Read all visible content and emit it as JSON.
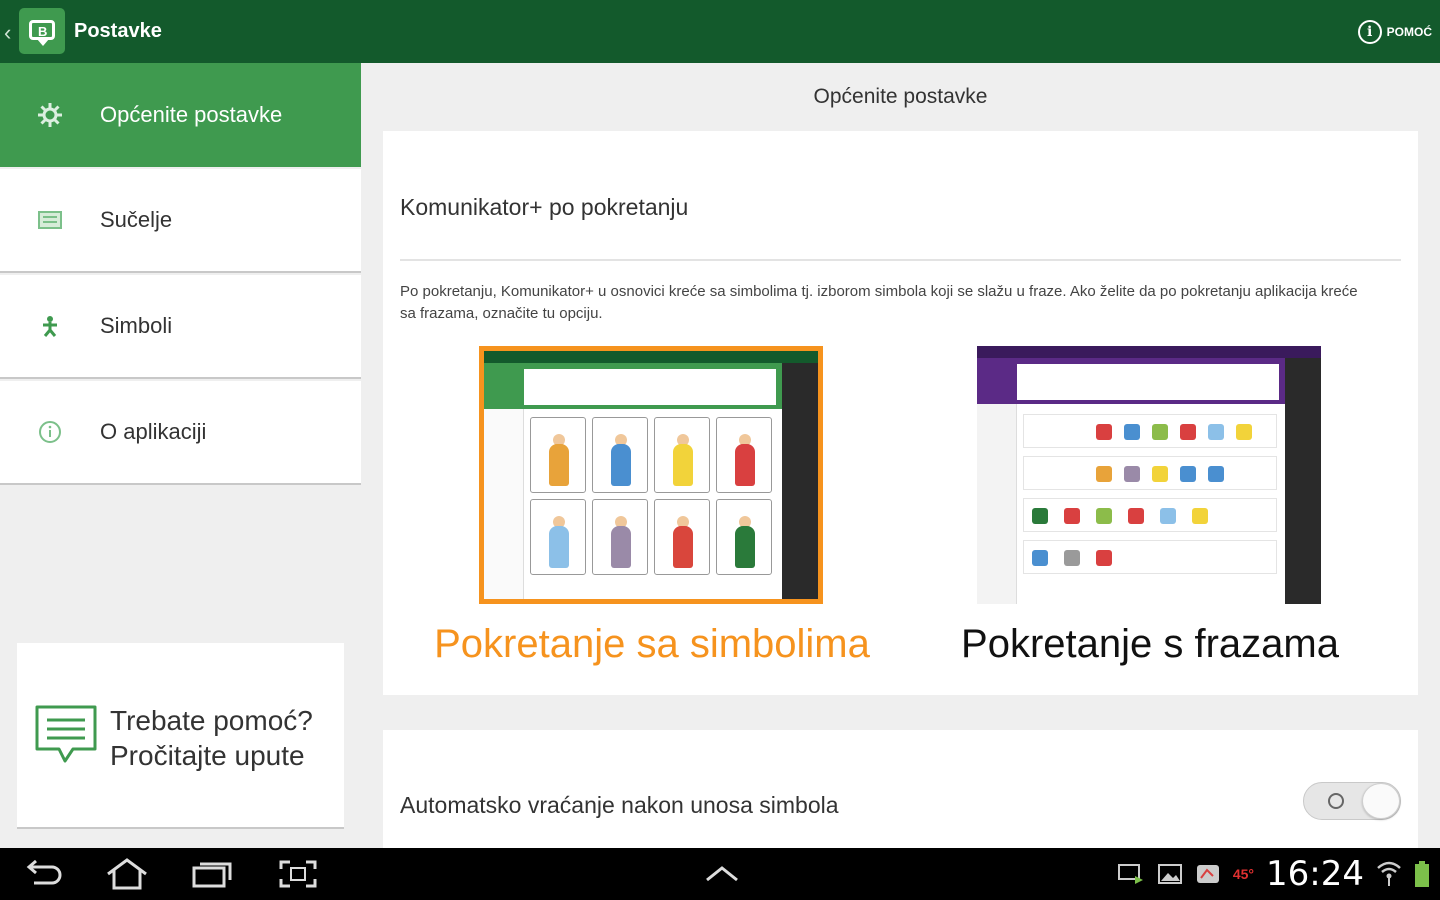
{
  "app": {
    "title": "Postavke",
    "logo_letter": "B",
    "help_label": "POMOĆ"
  },
  "sidebar": {
    "items": [
      {
        "label": "Općenite postavke",
        "icon": "gear-icon",
        "active": true
      },
      {
        "label": "Sučelje",
        "icon": "interface-icon",
        "active": false
      },
      {
        "label": "Simboli",
        "icon": "symbols-icon",
        "active": false
      },
      {
        "label": "O aplikaciji",
        "icon": "info-icon",
        "active": false
      }
    ],
    "help_card": {
      "line1": "Trebate pomoć?",
      "line2": "Pročitajte upute"
    }
  },
  "main": {
    "section_title": "Općenite postavke",
    "startup": {
      "heading": "Komunikator+ po pokretanju",
      "description": "Po pokretanju, Komunikator+ u osnovici kreće sa simbolima tj. izborom simbola koji se slažu u fraze. Ako želite da po pokretanju aplikacija kreće sa frazama, označite tu opciju.",
      "options": [
        {
          "label": "Pokretanje sa simbolima",
          "selected": true,
          "color": "#f6931e"
        },
        {
          "label": "Pokretanje s frazama",
          "selected": false,
          "color": "#111111"
        }
      ]
    },
    "auto_return": {
      "label": "Automatsko vraćanje nakon unosa simbola",
      "enabled": false
    }
  },
  "status_bar": {
    "time": "16:24",
    "temperature": "45°"
  },
  "colors": {
    "topbar": "#135a2c",
    "accent_green": "#3f9a4f",
    "accent_orange": "#f6931e",
    "purple": "#5b2a86"
  }
}
